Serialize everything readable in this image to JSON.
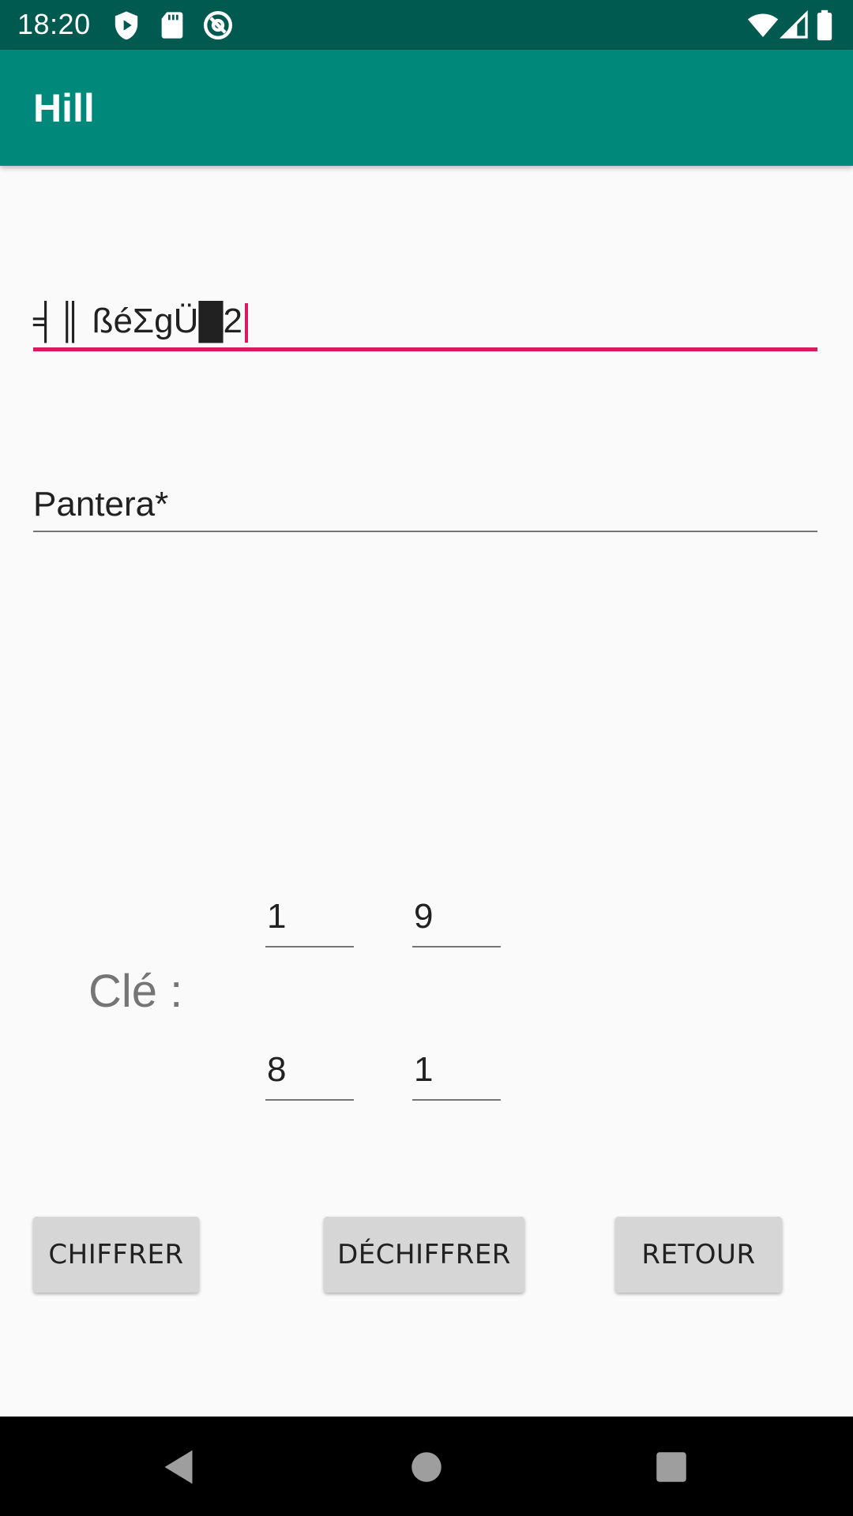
{
  "status_bar": {
    "time": "18:20",
    "left_icons": [
      "shield-play-icon",
      "sd-card-icon",
      "at-sign-icon"
    ],
    "right_icons": [
      "wifi-icon",
      "cell-signal-icon",
      "battery-icon"
    ]
  },
  "app_bar": {
    "title": "Hill"
  },
  "cipher_field": {
    "value": "╡║ ßéΣgÜ█2"
  },
  "plain_field": {
    "value": "Pantera*"
  },
  "key": {
    "label": "Clé :",
    "matrix": [
      [
        "1",
        "9"
      ],
      [
        "8",
        "1"
      ]
    ]
  },
  "buttons": {
    "encrypt": "CHIFFRER",
    "decrypt": "DÉCHIFFRER",
    "back": "RETOUR"
  },
  "nav_bar": {
    "icons": [
      "back-icon",
      "home-icon",
      "recents-icon"
    ]
  },
  "colors": {
    "status_bar": "#005a4f",
    "app_bar": "#00897b",
    "accent": "#d81b60",
    "background": "#fafafa",
    "button": "#d6d6d6"
  }
}
